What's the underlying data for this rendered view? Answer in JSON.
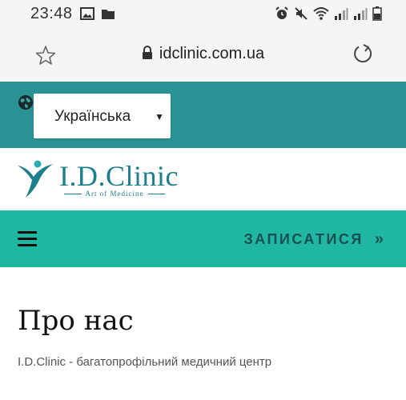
{
  "status_bar": {
    "time": "23:48",
    "left_icons": [
      "image-icon",
      "folder-icon"
    ],
    "right_icons": [
      "alarm-icon",
      "mute-icon",
      "wifi-icon",
      "signal-icon",
      "signal-icon",
      "battery-icon"
    ]
  },
  "browser": {
    "url": "idclinic.com.ua",
    "icons": [
      "star-icon",
      "lock-icon",
      "reload-icon"
    ]
  },
  "language": {
    "selected": "Українська",
    "icon": "globe-icon"
  },
  "logo": {
    "text": "I.D.Clinic",
    "tagline": "Art of Medicine"
  },
  "nav": {
    "signup_label": "ЗАПИСАТИСЯ",
    "signup_chevrons": "»",
    "menu_icon": "hamburger-icon"
  },
  "content": {
    "title": "Про нас",
    "subtitle": "I.D.Clinic - багатопрофільний медичний центр"
  },
  "colors": {
    "language_band": "#2a9294",
    "nav_band": "#1fb7a2",
    "logo": "#1d7f8c",
    "signup_text": "#1a4f52"
  }
}
